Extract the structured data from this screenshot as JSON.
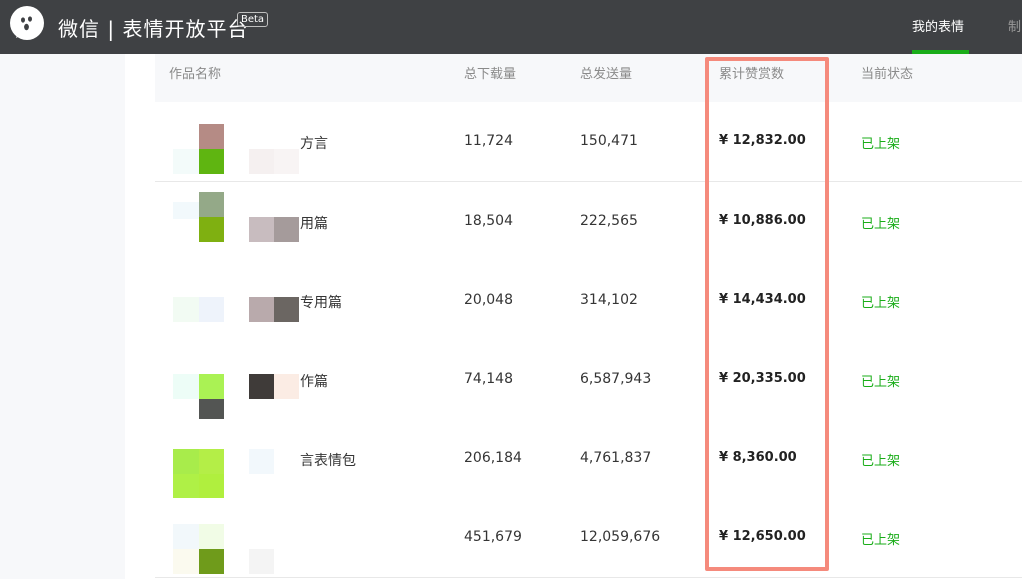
{
  "header": {
    "brand": "微信 | 表情开放平台",
    "beta": "Beta",
    "nav": [
      {
        "label": "我的表情"
      },
      {
        "label": "制"
      }
    ]
  },
  "table": {
    "columns": [
      "作品名称",
      "总下载量",
      "总发送量",
      "累计赞赏数",
      "当前状态"
    ],
    "rows": [
      {
        "name": "方言",
        "downloads": "11,724",
        "sends": "150,471",
        "reward": "¥ 12,832.00",
        "status": "已上架"
      },
      {
        "name": "用篇",
        "downloads": "18,504",
        "sends": "222,565",
        "reward": "¥ 10,886.00",
        "status": "已上架"
      },
      {
        "name": "专用篇",
        "downloads": "20,048",
        "sends": "314,102",
        "reward": "¥ 14,434.00",
        "status": "已上架"
      },
      {
        "name": "作篇",
        "downloads": "74,148",
        "sends": "6,587,943",
        "reward": "¥ 20,335.00",
        "status": "已上架"
      },
      {
        "name": "言表情包",
        "downloads": "206,184",
        "sends": "4,761,837",
        "reward": "¥ 8,360.00",
        "status": "已上架"
      },
      {
        "name": "",
        "downloads": "451,679",
        "sends": "12,059,676",
        "reward": "¥ 12,650.00",
        "status": "已上架"
      }
    ]
  },
  "colors": {
    "topbar": "#3f4144",
    "accent_green": "#1aad19",
    "highlight_border": "#f58a7c"
  }
}
